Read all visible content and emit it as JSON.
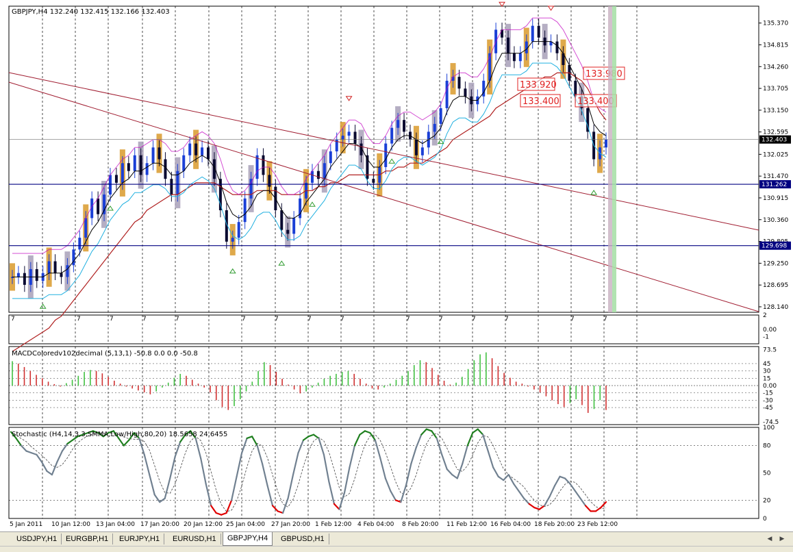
{
  "window": {
    "symbol_header": "GBPJPY,H4  132.240 132.415 132.166 132.403",
    "current_price": "132.403"
  },
  "colors": {
    "background": "#ffffff",
    "grid": "#000000",
    "bull_candle": "#1a3fd6",
    "bear_candle": "#0a0a30",
    "orange_bar": "#d99a2b",
    "grey_bar": "#a8a0b8",
    "ma_fast": "#000000",
    "ma_slow": "#b02020",
    "trendline": "#a01c30",
    "hline": "#000080",
    "trail_magenta": "#c000c0",
    "trail_cyan": "#20b0e0",
    "macd_up": "#40c040",
    "macd_down": "#d03030",
    "stoch_main": "#708090",
    "stoch_high": "#208020",
    "stoch_low": "#e00000",
    "label_box": "#e02020"
  },
  "chart_data": [
    {
      "type": "candlestick",
      "title": "GBPJPY,H4  132.240 132.415 132.166 132.403",
      "y_ticks": [
        "135.370",
        "134.815",
        "134.260",
        "133.705",
        "133.150",
        "132.595",
        "132.025",
        "131.470",
        "130.915",
        "130.360",
        "129.805",
        "129.250",
        "128.695",
        "128.140"
      ],
      "ylim": [
        128.0,
        135.8
      ],
      "x_ticks": [
        "5 Jan 2011",
        "10 Jan 12:00",
        "13 Jan 04:00",
        "17 Jan 20:00",
        "20 Jan 12:00",
        "25 Jan 04:00",
        "27 Jan 20:00",
        "1 Feb 12:00",
        "4 Feb 04:00",
        "8 Feb 20:00",
        "11 Feb 12:00",
        "16 Feb 04:00",
        "18 Feb 20:00",
        "23 Feb 12:00"
      ],
      "horizontal_lines": [
        {
          "value": 131.262,
          "label": "131.262"
        },
        {
          "value": 129.698,
          "label": "129.698"
        },
        {
          "value": 132.403,
          "label": "132.403"
        }
      ],
      "box_labels": [
        {
          "text": "133.920",
          "value": 133.92
        },
        {
          "text": "133.980",
          "value": 133.98
        },
        {
          "text": "133.400",
          "value": 133.4
        },
        {
          "text": "133.400",
          "value": 133.4
        }
      ],
      "sub_marker": "7",
      "close_path": [
        128.9,
        129.0,
        128.7,
        129.1,
        128.8,
        129.0,
        129.3,
        129.0,
        128.9,
        129.2,
        129.6,
        129.9,
        130.4,
        130.9,
        130.5,
        131.0,
        131.5,
        131.3,
        131.8,
        131.6,
        132.0,
        131.5,
        131.8,
        132.2,
        131.9,
        131.4,
        131.0,
        131.6,
        132.0,
        132.3,
        132.0,
        132.2,
        131.9,
        131.4,
        130.6,
        129.8,
        129.9,
        130.3,
        130.9,
        131.4,
        132.0,
        131.5,
        131.2,
        130.6,
        130.1,
        130.0,
        130.4,
        130.9,
        131.3,
        131.6,
        131.4,
        131.8,
        132.1,
        132.4,
        132.5,
        132.6,
        132.3,
        132.0,
        131.4,
        131.3,
        131.7,
        132.3,
        132.7,
        132.9,
        132.6,
        132.4,
        132.0,
        132.2,
        132.6,
        132.8,
        133.2,
        133.9,
        134.0,
        133.7,
        133.5,
        133.3,
        133.5,
        133.9,
        134.6,
        135.2,
        135.0,
        134.6,
        134.4,
        134.6,
        134.9,
        135.3,
        135.0,
        134.8,
        134.9,
        134.6,
        134.3,
        133.9,
        133.5,
        133.2,
        132.6,
        131.9,
        132.2,
        132.4
      ],
      "ma_fast": [
        128.9,
        128.9,
        128.9,
        128.9,
        128.9,
        128.9,
        129.0,
        129.0,
        129.0,
        129.1,
        129.3,
        129.5,
        129.8,
        130.1,
        130.3,
        130.6,
        130.9,
        131.1,
        131.3,
        131.4,
        131.6,
        131.6,
        131.7,
        131.8,
        131.8,
        131.7,
        131.5,
        131.5,
        131.6,
        131.8,
        131.9,
        132.0,
        131.9,
        131.7,
        131.3,
        130.8,
        130.5,
        130.4,
        130.5,
        130.7,
        131.0,
        131.1,
        131.1,
        130.9,
        130.6,
        130.4,
        130.4,
        130.5,
        130.8,
        131.0,
        131.2,
        131.4,
        131.7,
        131.9,
        132.1,
        132.3,
        132.3,
        132.2,
        131.9,
        131.7,
        131.7,
        131.9,
        132.2,
        132.4,
        132.5,
        132.5,
        132.4,
        132.3,
        132.4,
        132.5,
        132.7,
        133.1,
        133.4,
        133.5,
        133.5,
        133.4,
        133.4,
        133.6,
        133.9,
        134.3,
        134.6,
        134.6,
        134.6,
        134.6,
        134.7,
        134.9,
        134.9,
        134.9,
        134.9,
        134.8,
        134.6,
        134.3,
        134.0,
        133.7,
        133.3,
        132.8,
        132.6,
        132.5
      ],
      "ma_slow": [
        127.0,
        127.1,
        127.2,
        127.3,
        127.4,
        127.5,
        127.6,
        127.8,
        127.9,
        128.1,
        128.3,
        128.5,
        128.7,
        128.9,
        129.1,
        129.3,
        129.5,
        129.7,
        129.9,
        130.1,
        130.3,
        130.4,
        130.6,
        130.7,
        130.8,
        130.9,
        131.0,
        131.0,
        131.1,
        131.2,
        131.3,
        131.3,
        131.3,
        131.3,
        131.2,
        131.1,
        131.0,
        131.0,
        131.0,
        131.0,
        131.1,
        131.1,
        131.1,
        131.1,
        131.0,
        131.0,
        131.0,
        131.0,
        131.1,
        131.1,
        131.2,
        131.2,
        131.3,
        131.3,
        131.4,
        131.5,
        131.5,
        131.5,
        131.5,
        131.5,
        131.5,
        131.6,
        131.6,
        131.7,
        131.7,
        131.8,
        131.8,
        131.8,
        131.9,
        132.0,
        132.1,
        132.2,
        132.4,
        132.5,
        132.6,
        132.7,
        132.8,
        132.9,
        133.0,
        133.2,
        133.3,
        133.4,
        133.5,
        133.6,
        133.7,
        133.8,
        133.9,
        134.0,
        134.0,
        134.1,
        134.1,
        134.1,
        134.0,
        133.9,
        133.7,
        133.4,
        133.1,
        132.9
      ]
    },
    {
      "type": "bar",
      "title": "",
      "ylim": [
        -2,
        2
      ],
      "y_ticks": [
        "2",
        "0.00",
        "-1"
      ]
    },
    {
      "type": "bar",
      "title": "MACDColoredv102decimal (5,13,1) -50.8 0.0 0.0 -50.8",
      "ylim": [
        -80,
        80
      ],
      "y_ticks": [
        "73.5",
        "45",
        "30",
        "15",
        "0.00",
        "-15",
        "-30",
        "-45",
        "-74.5"
      ],
      "values": [
        50,
        45,
        38,
        30,
        22,
        15,
        8,
        3,
        -2,
        5,
        12,
        20,
        28,
        32,
        30,
        25,
        18,
        10,
        4,
        -2,
        -6,
        -10,
        -14,
        -18,
        -12,
        -4,
        6,
        16,
        24,
        20,
        12,
        4,
        -4,
        -14,
        -30,
        -44,
        -50,
        -42,
        -28,
        -12,
        8,
        30,
        48,
        42,
        28,
        14,
        2,
        -8,
        -16,
        -12,
        -4,
        6,
        14,
        20,
        24,
        28,
        30,
        24,
        14,
        4,
        -6,
        -8,
        -4,
        4,
        12,
        20,
        30,
        42,
        52,
        48,
        36,
        22,
        10,
        2,
        6,
        18,
        34,
        52,
        64,
        68,
        56,
        40,
        26,
        16,
        8,
        4,
        -2,
        -8,
        -14,
        -22,
        -30,
        -38,
        -44,
        -36,
        -28,
        -40,
        -56,
        -48,
        -30,
        -50
      ]
    },
    {
      "type": "line",
      "title": "Stochastic (H4,14,3,3,SMMA,Low/High,80,20) 18.5658 24.6455",
      "ylim": [
        0,
        100
      ],
      "y_ticks": [
        "100",
        "80",
        "50",
        "20",
        "0"
      ],
      "levels": [
        80,
        20
      ],
      "main": [
        95,
        88,
        80,
        74,
        72,
        70,
        62,
        52,
        48,
        62,
        74,
        82,
        86,
        90,
        92,
        94,
        96,
        94,
        90,
        94,
        96,
        88,
        80,
        86,
        94,
        88,
        70,
        48,
        26,
        18,
        22,
        44,
        68,
        84,
        92,
        96,
        88,
        66,
        38,
        14,
        6,
        4,
        6,
        20,
        46,
        72,
        88,
        90,
        80,
        60,
        36,
        14,
        8,
        6,
        22,
        48,
        72,
        86,
        90,
        92,
        88,
        70,
        40,
        16,
        10,
        28,
        56,
        80,
        92,
        96,
        94,
        86,
        66,
        44,
        30,
        20,
        18,
        36,
        60,
        78,
        92,
        98,
        96,
        88,
        70,
        54,
        48,
        44,
        60,
        80,
        94,
        98,
        92,
        74,
        56,
        46,
        42,
        48,
        38,
        30,
        22,
        16,
        12,
        10,
        14,
        24,
        36,
        46,
        44,
        38,
        30,
        22,
        14,
        8,
        8,
        12,
        18
      ]
    }
  ],
  "tabs": [
    {
      "label": "USDJPY,H1"
    },
    {
      "label": "EURGBP,H1"
    },
    {
      "label": "EURJPY,H1"
    },
    {
      "label": "EURUSD,H1"
    },
    {
      "label": "GBPJPY,H4"
    },
    {
      "label": "GBPUSD,H1"
    }
  ]
}
